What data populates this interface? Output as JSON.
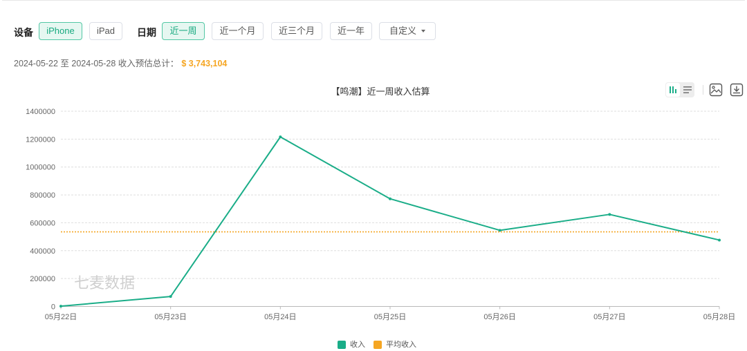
{
  "filters": {
    "device_label": "设备",
    "devices": [
      {
        "label": "iPhone",
        "active": true
      },
      {
        "label": "iPad",
        "active": false
      }
    ],
    "date_label": "日期",
    "ranges": [
      {
        "label": "近一周",
        "active": true
      },
      {
        "label": "近一个月",
        "active": false
      },
      {
        "label": "近三个月",
        "active": false
      },
      {
        "label": "近一年",
        "active": false
      }
    ],
    "custom_label": "自定义"
  },
  "summary": {
    "range_text": "2024-05-22 至 2024-05-28 收入预估总计：",
    "total": "$ 3,743,104"
  },
  "toolbar": {
    "icons": [
      "bar-chart-icon",
      "list-icon",
      "save-image-icon",
      "download-icon"
    ],
    "active": "bar-chart-icon"
  },
  "colors": {
    "accent": "#1aad88",
    "average": "#f5a623",
    "active_button_bg": "#e6f7f1"
  },
  "chart_data": {
    "type": "line",
    "title": "【鸣潮】近一周收入估算",
    "categories": [
      "05月22日",
      "05月23日",
      "05月24日",
      "05月25日",
      "05月26日",
      "05月27日",
      "05月28日"
    ],
    "series": [
      {
        "name": "收入",
        "color": "#1aad88",
        "values": [
          2104,
          71000,
          1216000,
          772000,
          546000,
          660000,
          476000
        ]
      },
      {
        "name": "平均收入",
        "color": "#f5a623",
        "style": "dotted",
        "values": [
          534729,
          534729,
          534729,
          534729,
          534729,
          534729,
          534729
        ]
      }
    ],
    "xlabel": "",
    "ylabel": "",
    "ylim": [
      0,
      1400000
    ],
    "yticks": [
      0,
      200000,
      400000,
      600000,
      800000,
      1000000,
      1200000,
      1400000
    ],
    "grid": true,
    "legend": "bottom-center",
    "watermark": "七麦数据"
  }
}
